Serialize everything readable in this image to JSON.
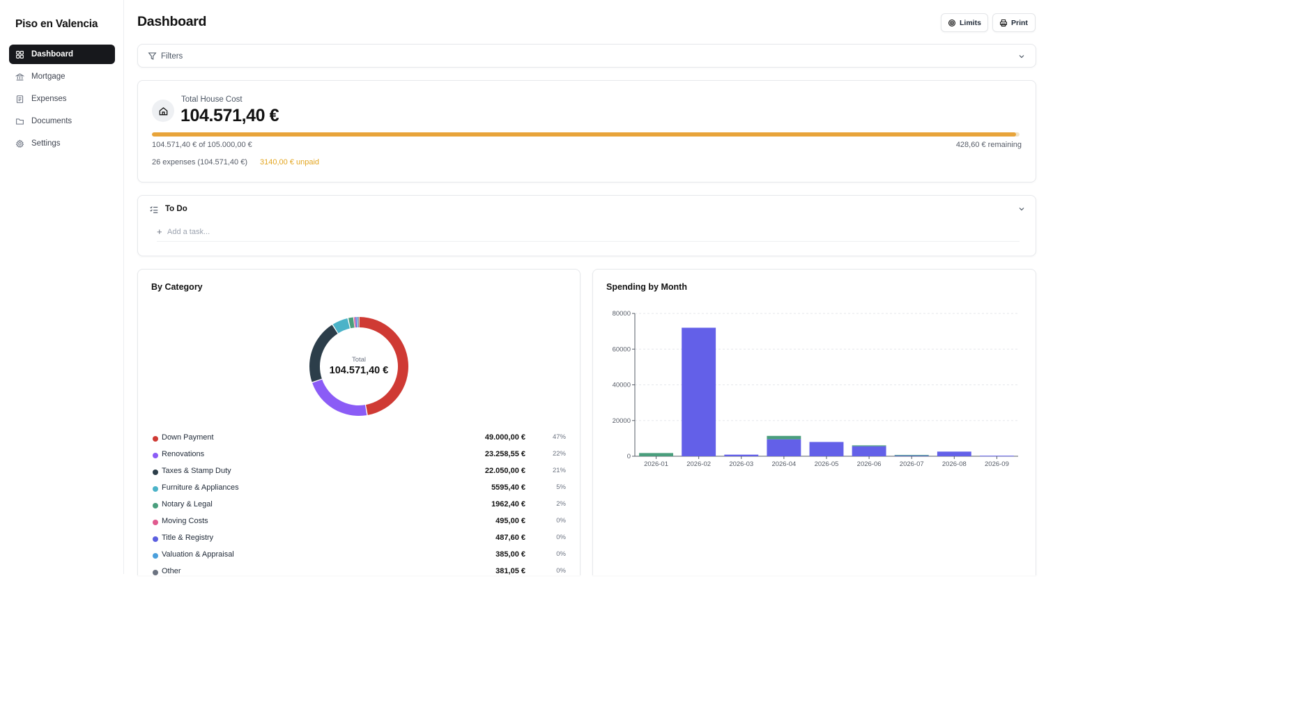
{
  "sidebar": {
    "brand": "Piso en Valencia",
    "items": [
      {
        "label": "Dashboard",
        "icon": "dashboard-icon",
        "active": true
      },
      {
        "label": "Mortgage",
        "icon": "bank-icon",
        "active": false
      },
      {
        "label": "Expenses",
        "icon": "receipt-icon",
        "active": false
      },
      {
        "label": "Documents",
        "icon": "folder-icon",
        "active": false
      },
      {
        "label": "Settings",
        "icon": "gear-icon",
        "active": false
      }
    ]
  },
  "header": {
    "title": "Dashboard",
    "limits_label": "Limits",
    "print_label": "Print"
  },
  "filters": {
    "label": "Filters"
  },
  "total": {
    "label": "Total House Cost",
    "amount": "104.571,40 €",
    "of_text": "104.571,40 € of 105.000,00 €",
    "remaining_text": "428,60 € remaining",
    "expenses_text": "26 expenses (104.571,40 €)",
    "unpaid_text": "3140,00 € unpaid",
    "progress": 0.9959,
    "colors": {
      "fill": "#e8a43a",
      "unpaid": "#e3a51f"
    }
  },
  "todo": {
    "title": "To Do",
    "add_placeholder": "Add a task..."
  },
  "category": {
    "title": "By Category",
    "center_label": "Total",
    "center_value": "104.571,40 €",
    "items": [
      {
        "name": "Down Payment",
        "value": "49.000,00 €",
        "pct": "47%",
        "amount": 49000.0,
        "color": "#cf3a34"
      },
      {
        "name": "Renovations",
        "value": "23.258,55 €",
        "pct": "22%",
        "amount": 23258.55,
        "color": "#8b5cf6"
      },
      {
        "name": "Taxes & Stamp Duty",
        "value": "22.050,00 €",
        "pct": "21%",
        "amount": 22050.0,
        "color": "#2c3e4a"
      },
      {
        "name": "Furniture & Appliances",
        "value": "5595,40 €",
        "pct": "5%",
        "amount": 5595.4,
        "color": "#4bb3c8"
      },
      {
        "name": "Notary & Legal",
        "value": "1962,40 €",
        "pct": "2%",
        "amount": 1962.4,
        "color": "#4a9e7d"
      },
      {
        "name": "Moving Costs",
        "value": "495,00 €",
        "pct": "0%",
        "amount": 495.0,
        "color": "#e05a8f"
      },
      {
        "name": "Title & Registry",
        "value": "487,60 €",
        "pct": "0%",
        "amount": 487.6,
        "color": "#5b5fe0"
      },
      {
        "name": "Valuation & Appraisal",
        "value": "385,00 €",
        "pct": "0%",
        "amount": 385.0,
        "color": "#4a9fdc"
      },
      {
        "name": "Other",
        "value": "381,05 €",
        "pct": "0%",
        "amount": 381.05,
        "color": "#6b7280"
      }
    ]
  },
  "chart_data": {
    "type": "bar",
    "title": "Spending by Month",
    "categories": [
      "2026-01",
      "2026-02",
      "2026-03",
      "2026-04",
      "2026-05",
      "2026-06",
      "2026-07",
      "2026-08",
      "2026-09"
    ],
    "stacked": true,
    "series": [
      {
        "color": "#6360e8",
        "values": [
          0,
          72000,
          900,
          9500,
          8000,
          5600,
          600,
          2600,
          300
        ]
      },
      {
        "color": "#4a9e7d",
        "values": [
          1800,
          0,
          0,
          1900,
          0,
          500,
          100,
          0,
          0
        ]
      }
    ],
    "ylim": [
      0,
      80000
    ],
    "yticks": [
      0,
      20000,
      40000,
      60000,
      80000
    ],
    "grid": true
  }
}
